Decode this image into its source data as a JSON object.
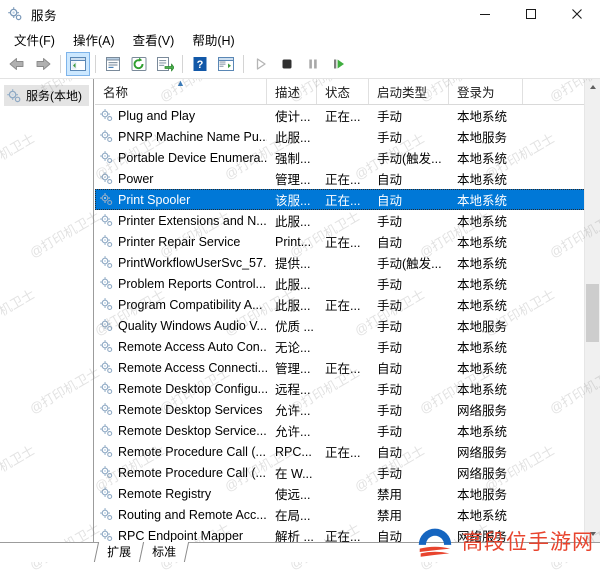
{
  "window": {
    "title": "服务",
    "icon": "services-gear-icon",
    "minimize_label": "—",
    "maximize_label": "□",
    "close_label": "✕"
  },
  "menubar": {
    "items": [
      {
        "label": "文件(F)",
        "accel": "F",
        "text": "文件"
      },
      {
        "label": "操作(A)",
        "accel": "A",
        "text": "操作"
      },
      {
        "label": "查看(V)",
        "accel": "V",
        "text": "查看"
      },
      {
        "label": "帮助(H)",
        "accel": "H",
        "text": "帮助"
      }
    ]
  },
  "toolbar": {
    "buttons": [
      {
        "name": "back-icon",
        "tip": "后退"
      },
      {
        "name": "forward-icon",
        "tip": "前进"
      },
      {
        "name": "show-hide-tree-icon",
        "tip": "显示/隐藏控制台树",
        "active": true
      },
      {
        "name": "properties-icon",
        "tip": "属性"
      },
      {
        "name": "refresh-icon",
        "tip": "刷新"
      },
      {
        "name": "export-list-icon",
        "tip": "导出列表"
      },
      {
        "name": "help-icon",
        "tip": "帮助"
      },
      {
        "name": "show-action-pane-icon",
        "tip": "显示/隐藏操作窗格"
      },
      {
        "name": "play-icon",
        "tip": "启动服务"
      },
      {
        "name": "stop-icon",
        "tip": "停止服务"
      },
      {
        "name": "pause-icon",
        "tip": "暂停服务"
      },
      {
        "name": "restart-icon",
        "tip": "重启服务"
      }
    ]
  },
  "sidebar": {
    "items": [
      {
        "label": "服务(本地)",
        "icon": "services-gear-icon",
        "selected": true
      }
    ]
  },
  "list": {
    "columns": [
      {
        "key": "name",
        "label": "名称",
        "sorted": true,
        "sort_dir": "asc"
      },
      {
        "key": "description",
        "label": "描述"
      },
      {
        "key": "status",
        "label": "状态"
      },
      {
        "key": "startup",
        "label": "启动类型"
      },
      {
        "key": "logon",
        "label": "登录为"
      }
    ],
    "rows": [
      {
        "name": "Plug and Play",
        "description": "使计...",
        "status": "正在...",
        "startup": "手动",
        "logon": "本地系统",
        "selected": false
      },
      {
        "name": "PNRP Machine Name Pu...",
        "description": "此服...",
        "status": "",
        "startup": "手动",
        "logon": "本地服务",
        "selected": false
      },
      {
        "name": "Portable Device Enumera...",
        "description": "强制...",
        "status": "",
        "startup": "手动(触发...",
        "logon": "本地系统",
        "selected": false
      },
      {
        "name": "Power",
        "description": "管理...",
        "status": "正在...",
        "startup": "自动",
        "logon": "本地系统",
        "selected": false
      },
      {
        "name": "Print Spooler",
        "description": "该服...",
        "status": "正在...",
        "startup": "自动",
        "logon": "本地系统",
        "selected": true
      },
      {
        "name": "Printer Extensions and N...",
        "description": "此服...",
        "status": "",
        "startup": "手动",
        "logon": "本地系统",
        "selected": false
      },
      {
        "name": "Printer Repair Service",
        "description": "Print...",
        "status": "正在...",
        "startup": "自动",
        "logon": "本地系统",
        "selected": false
      },
      {
        "name": "PrintWorkflowUserSvc_57...",
        "description": "提供...",
        "status": "",
        "startup": "手动(触发...",
        "logon": "本地系统",
        "selected": false
      },
      {
        "name": "Problem Reports Control...",
        "description": "此服...",
        "status": "",
        "startup": "手动",
        "logon": "本地系统",
        "selected": false
      },
      {
        "name": "Program Compatibility A...",
        "description": "此服...",
        "status": "正在...",
        "startup": "手动",
        "logon": "本地系统",
        "selected": false
      },
      {
        "name": "Quality Windows Audio V...",
        "description": "优质 ...",
        "status": "",
        "startup": "手动",
        "logon": "本地服务",
        "selected": false
      },
      {
        "name": "Remote Access Auto Con...",
        "description": "无论...",
        "status": "",
        "startup": "手动",
        "logon": "本地系统",
        "selected": false
      },
      {
        "name": "Remote Access Connecti...",
        "description": "管理...",
        "status": "正在...",
        "startup": "自动",
        "logon": "本地系统",
        "selected": false
      },
      {
        "name": "Remote Desktop Configu...",
        "description": "远程...",
        "status": "",
        "startup": "手动",
        "logon": "本地系统",
        "selected": false
      },
      {
        "name": "Remote Desktop Services",
        "description": "允许...",
        "status": "",
        "startup": "手动",
        "logon": "网络服务",
        "selected": false
      },
      {
        "name": "Remote Desktop Service...",
        "description": "允许...",
        "status": "",
        "startup": "手动",
        "logon": "本地系统",
        "selected": false
      },
      {
        "name": "Remote Procedure Call (...",
        "description": "RPC...",
        "status": "正在...",
        "startup": "自动",
        "logon": "网络服务",
        "selected": false
      },
      {
        "name": "Remote Procedure Call (...",
        "description": "在 W...",
        "status": "",
        "startup": "手动",
        "logon": "网络服务",
        "selected": false
      },
      {
        "name": "Remote Registry",
        "description": "使远...",
        "status": "",
        "startup": "禁用",
        "logon": "本地服务",
        "selected": false
      },
      {
        "name": "Routing and Remote Acc...",
        "description": "在局...",
        "status": "",
        "startup": "禁用",
        "logon": "本地系统",
        "selected": false
      },
      {
        "name": "RPC Endpoint Mapper",
        "description": "解析 ...",
        "status": "正在...",
        "startup": "自动",
        "logon": "网络服务",
        "selected": false
      }
    ]
  },
  "tabs": [
    {
      "label": "扩展",
      "active": false
    },
    {
      "label": "标准",
      "active": true
    }
  ],
  "watermark": {
    "text": "@打印机卫士"
  },
  "logo": {
    "text": "高段位手游网",
    "mark_color_primary": "#1565c0",
    "mark_color_secondary": "#e8442e",
    "text_color": "#e8442e"
  },
  "colors": {
    "selection": "#0078d7",
    "selection_text": "#ffffff",
    "toolbar_active": "#cce8ff"
  }
}
